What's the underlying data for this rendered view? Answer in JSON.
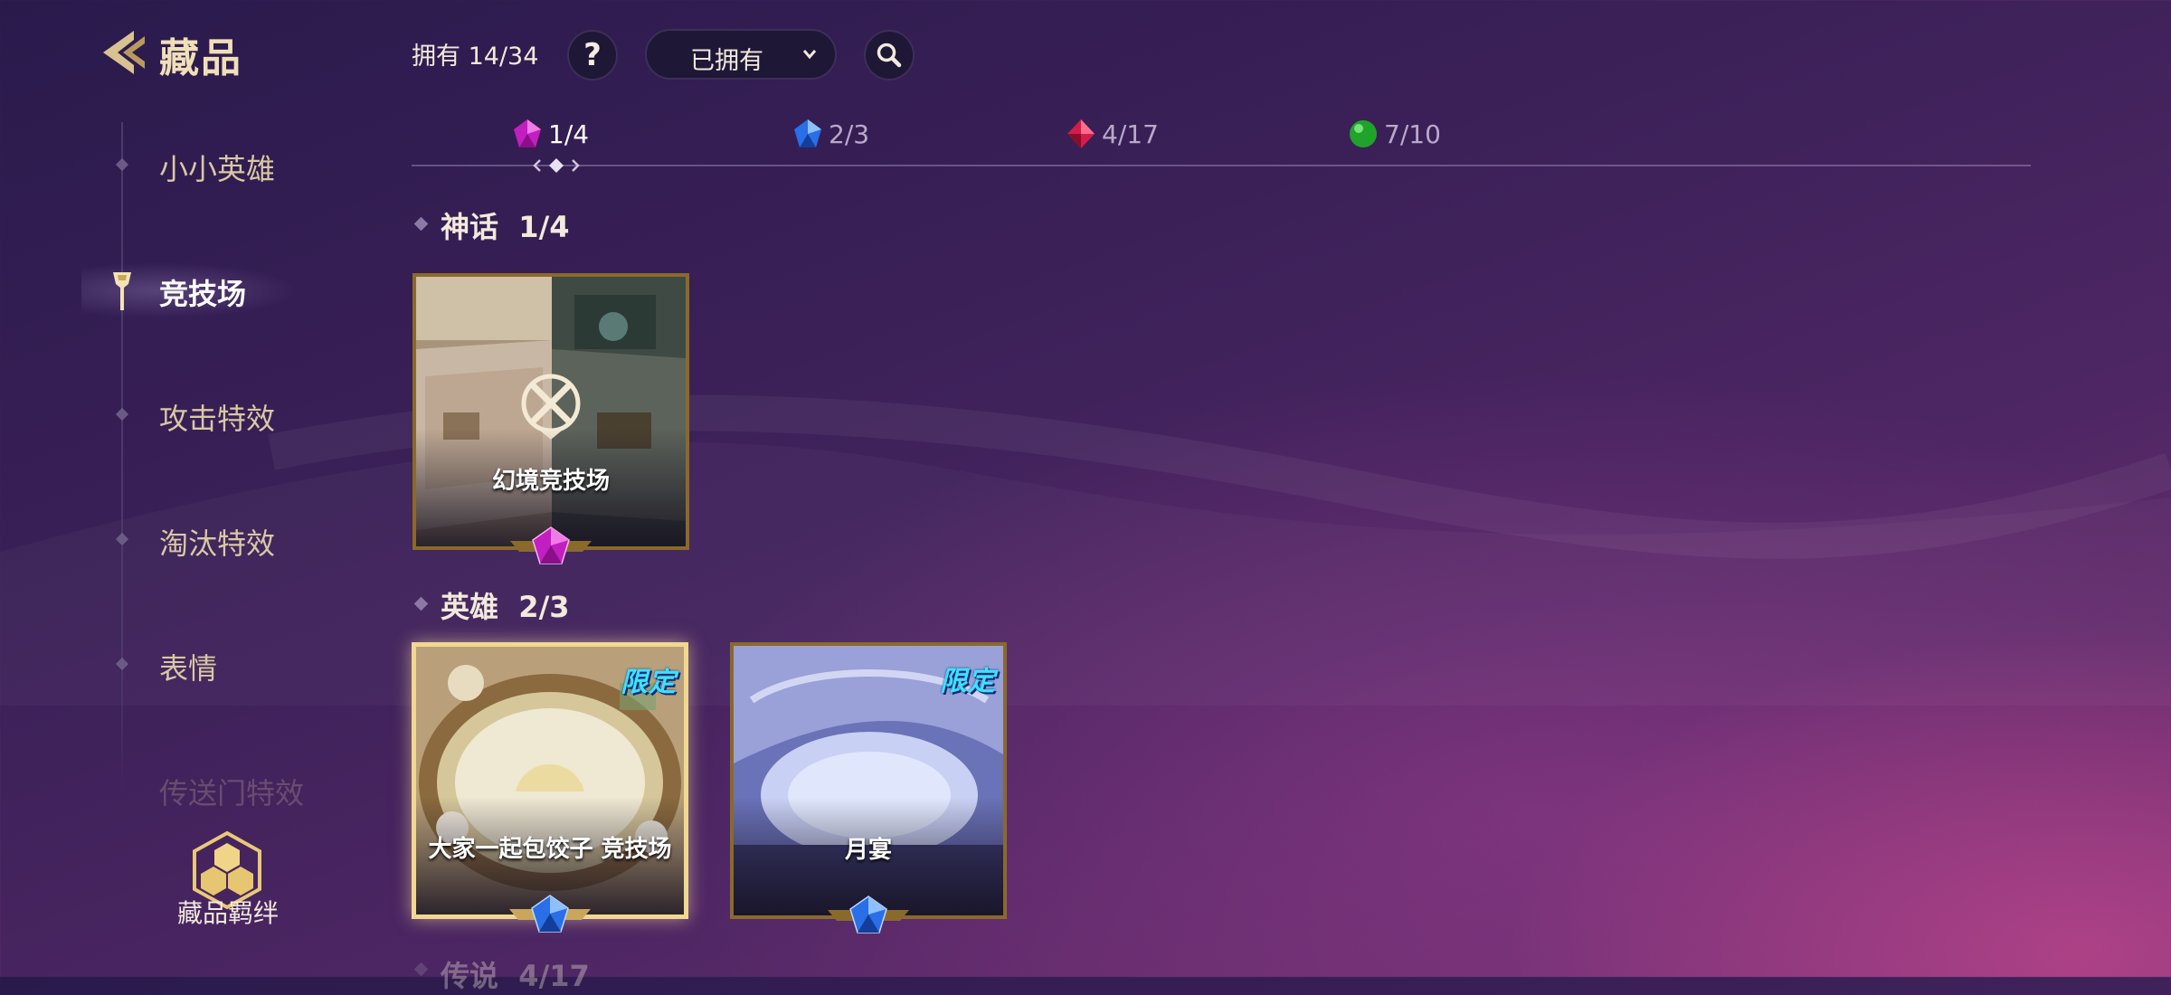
{
  "header": {
    "title": "藏品",
    "owned_label": "拥有 14/34",
    "help_label": "?",
    "filter_value": "已拥有"
  },
  "sidebar": {
    "items": [
      {
        "label": "小小英雄"
      },
      {
        "label": "竞技场",
        "active": true
      },
      {
        "label": "攻击特效"
      },
      {
        "label": "淘汰特效"
      },
      {
        "label": "表情"
      },
      {
        "label": "传送门特效"
      }
    ],
    "bond_label": "藏品羁绊"
  },
  "rarity_tabs": [
    {
      "count": "1/4",
      "gem": "purple-gem-icon",
      "color": "#c21fc0",
      "active": true
    },
    {
      "count": "2/3",
      "gem": "blue-gem-icon",
      "color": "#2a6ee8"
    },
    {
      "count": "4/17",
      "gem": "red-gem-icon",
      "color": "#d21d4a"
    },
    {
      "count": "7/10",
      "gem": "green-orb-icon",
      "color": "#1fa32a"
    }
  ],
  "sections": [
    {
      "title": "神话",
      "count": "1/4",
      "cards": [
        {
          "name": "幻境竞技场",
          "gem": "purple-gem-icon"
        }
      ]
    },
    {
      "title": "英雄",
      "count": "2/3",
      "cards": [
        {
          "name": "大家一起包饺子 竞技场",
          "gem": "blue-gem-icon",
          "badge": "限定",
          "selected": true
        },
        {
          "name": "月宴",
          "gem": "blue-gem-icon",
          "badge": "限定"
        }
      ]
    },
    {
      "title": "传说",
      "count": "4/17"
    }
  ]
}
